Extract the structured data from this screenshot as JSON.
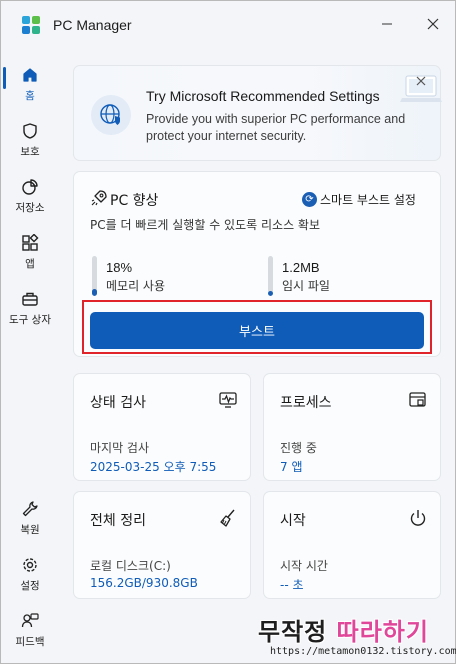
{
  "app": {
    "title": "PC Manager"
  },
  "sidebar": {
    "items": [
      {
        "label": "홈",
        "icon": "home-icon"
      },
      {
        "label": "보호",
        "icon": "shield-icon"
      },
      {
        "label": "저장소",
        "icon": "pie-chart-icon"
      },
      {
        "label": "앱",
        "icon": "apps-grid-icon"
      },
      {
        "label": "도구 상자",
        "icon": "toolbox-icon"
      },
      {
        "label": "복원",
        "icon": "wrench-icon"
      },
      {
        "label": "설정",
        "icon": "gear-icon"
      },
      {
        "label": "피드백",
        "icon": "feedback-icon"
      }
    ]
  },
  "banner": {
    "title": "Try Microsoft Recommended Settings",
    "text": "Provide you with superior PC performance and protect your internet security."
  },
  "boost": {
    "title": "PC 향상",
    "smart_link": "스마트 부스트 설정",
    "subtitle": "PC를 더 빠르게 실행할 수 있도록 리소스 확보",
    "memory_value": "18%",
    "memory_label": "메모리 사용",
    "memory_fill": 0.18,
    "temp_value": "1.2MB",
    "temp_label": "임시 파일",
    "temp_fill": 0.12,
    "button_label": "부스트"
  },
  "tiles": {
    "health": {
      "title": "상태 검사",
      "label": "마지막 검사",
      "value": "2025-03-25 오후 7:55"
    },
    "process": {
      "title": "프로세스",
      "label": "진행 중",
      "value": "7 앱"
    },
    "cleanup": {
      "title": "전체 정리",
      "label": "로컬 디스크(C:)",
      "value": "156.2GB/930.8GB"
    },
    "startup": {
      "title": "시작",
      "label": "시작 시간",
      "value": "-- 초"
    }
  },
  "watermark": {
    "part1": "무작정",
    "part2": "따라하기",
    "url": "https://metamon0132.tistory.com/"
  },
  "colors": {
    "accent": "#0f5cb8",
    "highlight": "#e0232b"
  }
}
